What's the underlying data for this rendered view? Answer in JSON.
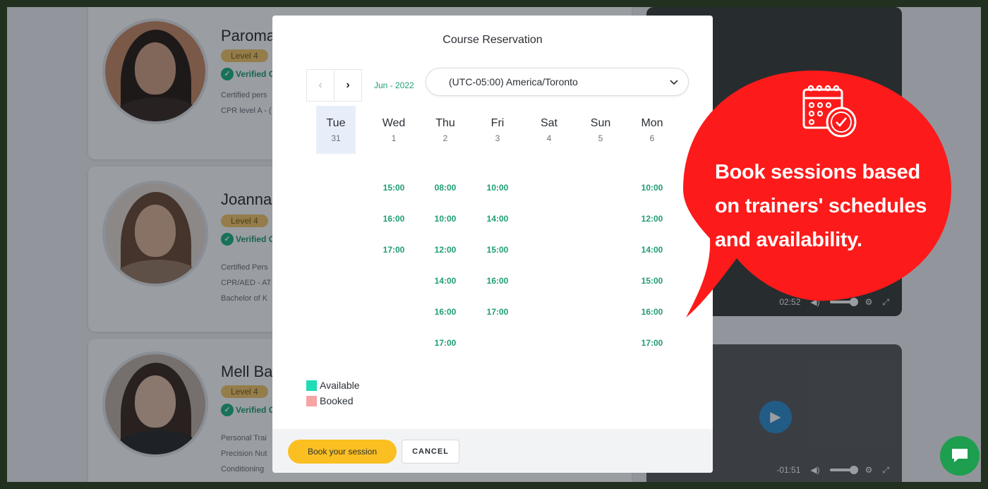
{
  "trainers": [
    {
      "name": "Paroma",
      "level": "Level 4",
      "verified": "Verified C",
      "details": [
        "Certified pers",
        "CPR level A - ("
      ]
    },
    {
      "name": "Joanna",
      "level": "Level 4",
      "verified": "Verified C",
      "details": [
        "Certified Pers",
        "CPR/AED - AT",
        "Bachelor of K"
      ]
    },
    {
      "name": "Mell Ba",
      "level": "Level 4",
      "verified": "Verified C",
      "details": [
        "Personal Trai",
        "Precision Nut",
        "Conditioning"
      ]
    }
  ],
  "videos": [
    {
      "time": "02:52"
    },
    {
      "time": "-01:51"
    }
  ],
  "modal": {
    "title": "Course Reservation",
    "month": "Jun - 2022",
    "timezone": "(UTC-05:00) America/Toronto",
    "days": [
      {
        "name": "Tue",
        "date": "31",
        "selected": true,
        "slots": []
      },
      {
        "name": "Wed",
        "date": "1",
        "selected": false,
        "slots": [
          "15:00",
          "16:00",
          "17:00"
        ]
      },
      {
        "name": "Thu",
        "date": "2",
        "selected": false,
        "slots": [
          "08:00",
          "10:00",
          "12:00",
          "14:00",
          "16:00",
          "17:00"
        ]
      },
      {
        "name": "Fri",
        "date": "3",
        "selected": false,
        "slots": [
          "10:00",
          "14:00",
          "15:00",
          "16:00",
          "17:00"
        ]
      },
      {
        "name": "Sat",
        "date": "4",
        "selected": false,
        "slots": []
      },
      {
        "name": "Sun",
        "date": "5",
        "selected": false,
        "slots": []
      },
      {
        "name": "Mon",
        "date": "6",
        "selected": false,
        "slots": [
          "10:00",
          "12:00",
          "14:00",
          "15:00",
          "16:00",
          "17:00"
        ]
      }
    ],
    "legend": [
      {
        "label": "Available",
        "color": "#1fdcb7"
      },
      {
        "label": "Booked",
        "color": "#f6a4a4"
      }
    ],
    "book_label": "Book your session",
    "cancel_label": "CANCEL"
  },
  "callout": {
    "lines": [
      "Book sessions based",
      "on trainers' schedules",
      "and availability."
    ],
    "color": "#fd1a1a"
  },
  "colors": {
    "accent": "#1f9d74",
    "book_button": "#fbbf22",
    "chat": "#1e9e4f"
  }
}
